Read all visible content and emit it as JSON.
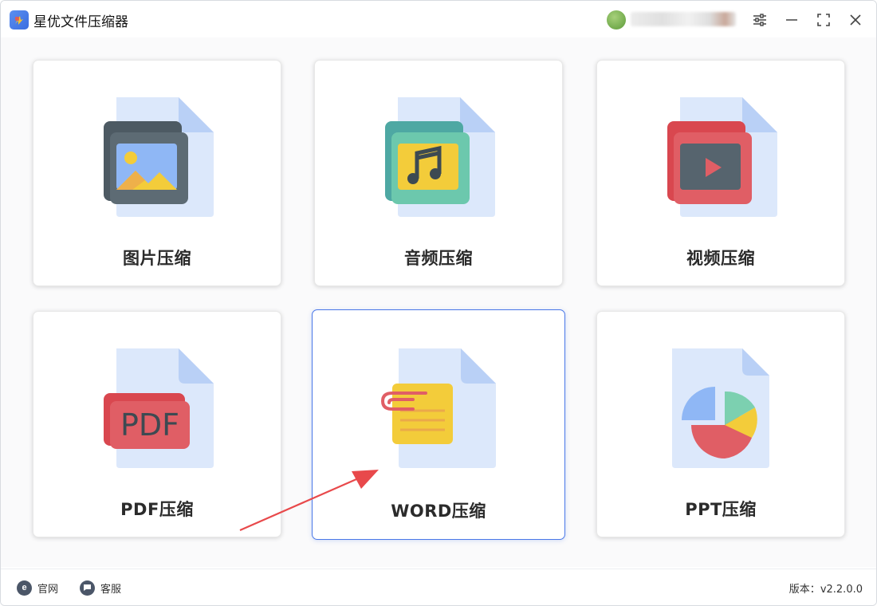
{
  "app": {
    "title": "星优文件压缩器"
  },
  "header": {
    "username": "",
    "controls": [
      "settings-icon",
      "minimize-icon",
      "maximize-icon",
      "close-icon"
    ]
  },
  "cards": [
    {
      "label": "图片压缩",
      "icon": "image-file-icon"
    },
    {
      "label": "音频压缩",
      "icon": "audio-file-icon"
    },
    {
      "label": "视频压缩",
      "icon": "video-file-icon"
    },
    {
      "label": "PDF压缩",
      "icon": "pdf-file-icon"
    },
    {
      "label": "WORD压缩",
      "icon": "word-file-icon",
      "selected": true
    },
    {
      "label": "PPT压缩",
      "icon": "ppt-file-icon"
    }
  ],
  "footer": {
    "site_label": "官网",
    "support_label": "客服",
    "version_label": "版本：",
    "version_value": "v2.2.0.0"
  },
  "colors": {
    "accent": "#4a78e8",
    "pointer_arrow": "#e8494b",
    "file_page": "#dce8fb"
  }
}
